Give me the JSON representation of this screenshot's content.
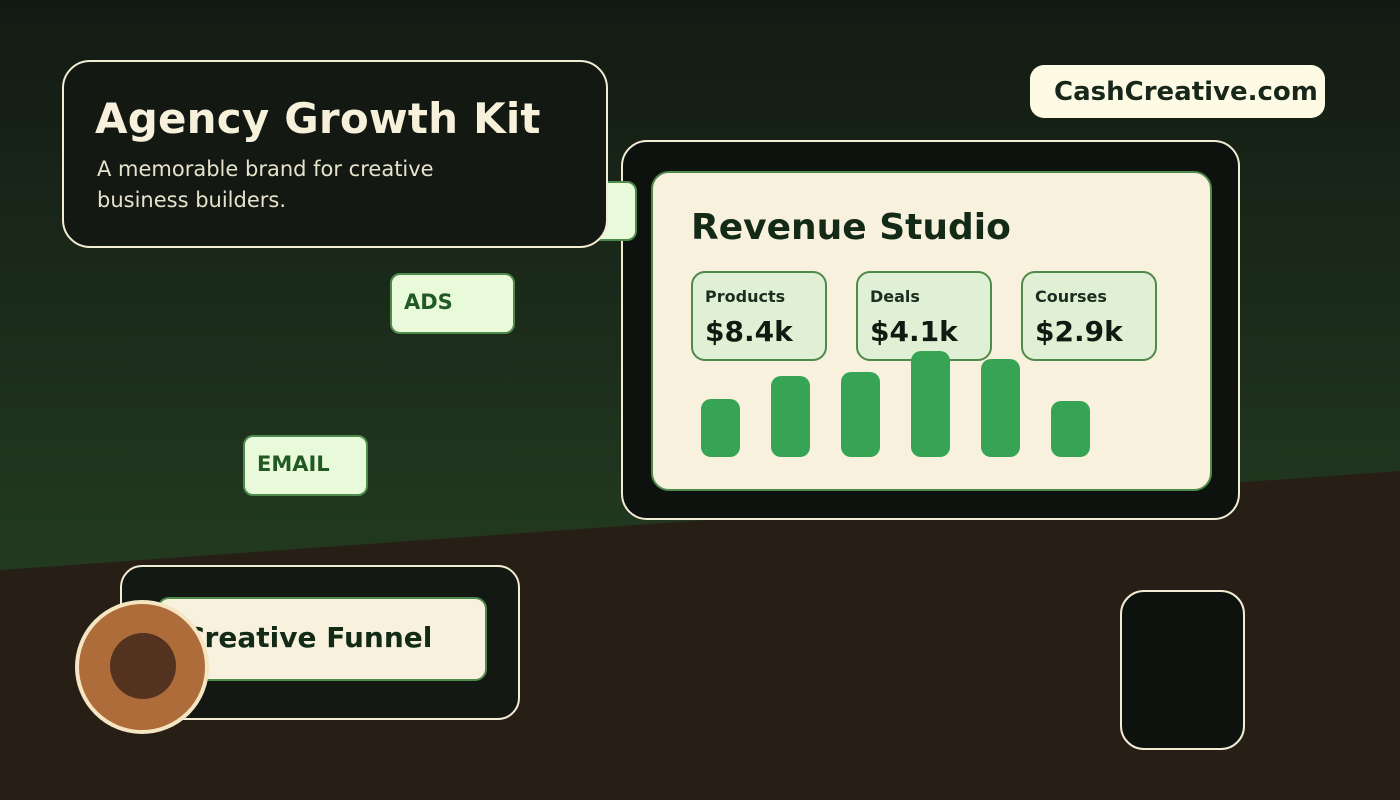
{
  "colors": {
    "background_top": "#131a13",
    "background_mid": "#223a20",
    "ground": "#271e16",
    "accent_green": "#37a455",
    "cream": "#f7f1de",
    "chip_green": "#e9fadb",
    "copper": "#ad6c3a"
  },
  "hero": {
    "title": "Agency Growth Kit",
    "subtitle": "A memorable brand for creative business builders."
  },
  "chips": [
    {
      "label": "ADS"
    },
    {
      "label": "EMAIL"
    }
  ],
  "brand": {
    "domain": "CashCreative.com"
  },
  "dashboard": {
    "title": "Revenue Studio",
    "stats": [
      {
        "label": "Products",
        "value": "$8.4k"
      },
      {
        "label": "Deals",
        "value": "$4.1k"
      },
      {
        "label": "Courses",
        "value": "$2.9k"
      }
    ],
    "bar_levels": [
      0.55,
      0.76,
      0.8,
      1.0,
      0.92,
      0.53
    ]
  },
  "funnel": {
    "label": "Creative Funnel"
  },
  "icons": {
    "coin": "coin-icon",
    "phone": "phone-device-icon"
  }
}
